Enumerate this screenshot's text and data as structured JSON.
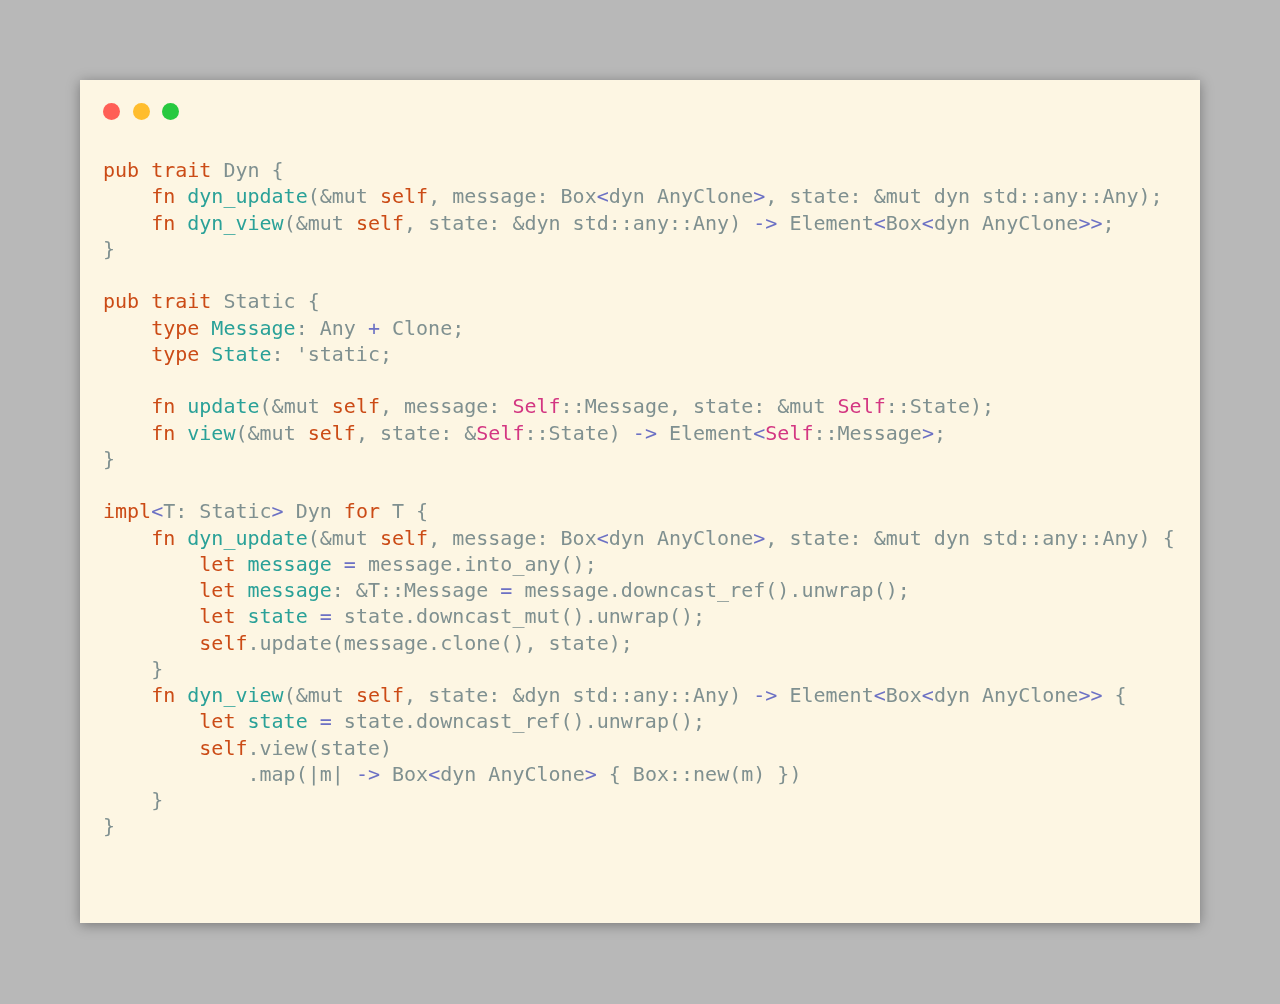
{
  "window": {
    "controls": [
      {
        "color": "#ff5f56"
      },
      {
        "color": "#ffbd2e"
      },
      {
        "color": "#27c93f"
      }
    ]
  },
  "code": {
    "blocks": [
      {
        "lines": [
          {
            "tokens": [
              {
                "text": "pub trait",
                "kind": "keyword"
              },
              {
                "text": " Dyn {",
                "kind": "plain"
              }
            ]
          },
          {
            "tokens": [
              {
                "text": "    fn",
                "kind": "keyword"
              },
              {
                "text": " dyn_update",
                "kind": "function"
              },
              {
                "text": "(&mut ",
                "kind": "plain"
              },
              {
                "text": "self",
                "kind": "keyword"
              },
              {
                "text": ", message: Box",
                "kind": "plain"
              },
              {
                "text": "<",
                "kind": "operator"
              },
              {
                "text": "dyn AnyClone",
                "kind": "plain"
              },
              {
                "text": ">",
                "kind": "operator"
              },
              {
                "text": ", state: &mut dyn std::any::Any);",
                "kind": "plain"
              }
            ]
          },
          {
            "tokens": [
              {
                "text": "    fn",
                "kind": "keyword"
              },
              {
                "text": " dyn_view",
                "kind": "function"
              },
              {
                "text": "(&mut ",
                "kind": "plain"
              },
              {
                "text": "self",
                "kind": "keyword"
              },
              {
                "text": ", state: &dyn std::any::Any) ",
                "kind": "plain"
              },
              {
                "text": "->",
                "kind": "operator"
              },
              {
                "text": " Element",
                "kind": "plain"
              },
              {
                "text": "<",
                "kind": "operator"
              },
              {
                "text": "Box",
                "kind": "plain"
              },
              {
                "text": "<",
                "kind": "operator"
              },
              {
                "text": "dyn AnyClone",
                "kind": "plain"
              },
              {
                "text": ">>",
                "kind": "operator"
              },
              {
                "text": ";",
                "kind": "plain"
              }
            ]
          },
          {
            "tokens": [
              {
                "text": "}",
                "kind": "plain"
              }
            ]
          }
        ]
      },
      {
        "lines": [
          {
            "tokens": [
              {
                "text": "pub trait",
                "kind": "keyword"
              },
              {
                "text": " Static {",
                "kind": "plain"
              }
            ]
          },
          {
            "tokens": [
              {
                "text": "    type",
                "kind": "keyword"
              },
              {
                "text": " Message",
                "kind": "function"
              },
              {
                "text": ": Any ",
                "kind": "plain"
              },
              {
                "text": "+",
                "kind": "operator"
              },
              {
                "text": " Clone;",
                "kind": "plain"
              }
            ]
          },
          {
            "tokens": [
              {
                "text": "    type",
                "kind": "keyword"
              },
              {
                "text": " State",
                "kind": "function"
              },
              {
                "text": ": 'static;",
                "kind": "plain"
              }
            ]
          }
        ]
      },
      {
        "lines": [
          {
            "tokens": [
              {
                "text": "    fn",
                "kind": "keyword"
              },
              {
                "text": " update",
                "kind": "function"
              },
              {
                "text": "(&mut ",
                "kind": "plain"
              },
              {
                "text": "self",
                "kind": "keyword"
              },
              {
                "text": ", message: ",
                "kind": "plain"
              },
              {
                "text": "Self",
                "kind": "self_type"
              },
              {
                "text": "::Message, state: &mut ",
                "kind": "plain"
              },
              {
                "text": "Self",
                "kind": "self_type"
              },
              {
                "text": "::State);",
                "kind": "plain"
              }
            ]
          },
          {
            "tokens": [
              {
                "text": "    fn",
                "kind": "keyword"
              },
              {
                "text": " view",
                "kind": "function"
              },
              {
                "text": "(&mut ",
                "kind": "plain"
              },
              {
                "text": "self",
                "kind": "keyword"
              },
              {
                "text": ", state: &",
                "kind": "plain"
              },
              {
                "text": "Self",
                "kind": "self_type"
              },
              {
                "text": "::State) ",
                "kind": "plain"
              },
              {
                "text": "->",
                "kind": "operator"
              },
              {
                "text": " Element",
                "kind": "plain"
              },
              {
                "text": "<",
                "kind": "operator"
              },
              {
                "text": "Self",
                "kind": "self_type"
              },
              {
                "text": "::Message",
                "kind": "plain"
              },
              {
                "text": ">",
                "kind": "operator"
              },
              {
                "text": ";",
                "kind": "plain"
              }
            ]
          },
          {
            "tokens": [
              {
                "text": "}",
                "kind": "plain"
              }
            ]
          }
        ]
      },
      {
        "lines": [
          {
            "tokens": [
              {
                "text": "impl",
                "kind": "keyword"
              },
              {
                "text": "<",
                "kind": "operator"
              },
              {
                "text": "T: Static",
                "kind": "plain"
              },
              {
                "text": ">",
                "kind": "operator"
              },
              {
                "text": " Dyn ",
                "kind": "plain"
              },
              {
                "text": "for",
                "kind": "keyword"
              },
              {
                "text": " T {",
                "kind": "plain"
              }
            ]
          },
          {
            "tokens": [
              {
                "text": "    fn",
                "kind": "keyword"
              },
              {
                "text": " dyn_update",
                "kind": "function"
              },
              {
                "text": "(&mut ",
                "kind": "plain"
              },
              {
                "text": "self",
                "kind": "keyword"
              },
              {
                "text": ", message: Box",
                "kind": "plain"
              },
              {
                "text": "<",
                "kind": "operator"
              },
              {
                "text": "dyn AnyClone",
                "kind": "plain"
              },
              {
                "text": ">",
                "kind": "operator"
              },
              {
                "text": ", state: &mut dyn std::any::Any) {",
                "kind": "plain"
              }
            ]
          },
          {
            "tokens": [
              {
                "text": "        let",
                "kind": "keyword"
              },
              {
                "text": " message",
                "kind": "function"
              },
              {
                "text": " =",
                "kind": "operator"
              },
              {
                "text": " message.into_any();",
                "kind": "plain"
              }
            ]
          },
          {
            "tokens": [
              {
                "text": "        let",
                "kind": "keyword"
              },
              {
                "text": " message",
                "kind": "function"
              },
              {
                "text": ": &T::Message ",
                "kind": "plain"
              },
              {
                "text": "=",
                "kind": "operator"
              },
              {
                "text": " message.downcast_ref().unwrap();",
                "kind": "plain"
              }
            ]
          },
          {
            "tokens": [
              {
                "text": "        let",
                "kind": "keyword"
              },
              {
                "text": " state",
                "kind": "function"
              },
              {
                "text": " =",
                "kind": "operator"
              },
              {
                "text": " state.downcast_mut().unwrap();",
                "kind": "plain"
              }
            ]
          },
          {
            "tokens": [
              {
                "text": "        self",
                "kind": "keyword"
              },
              {
                "text": ".update(message.clone(), state);",
                "kind": "plain"
              }
            ]
          },
          {
            "tokens": [
              {
                "text": "    }",
                "kind": "plain"
              }
            ]
          },
          {
            "tokens": [
              {
                "text": "    fn",
                "kind": "keyword"
              },
              {
                "text": " dyn_view",
                "kind": "function"
              },
              {
                "text": "(&mut ",
                "kind": "plain"
              },
              {
                "text": "self",
                "kind": "keyword"
              },
              {
                "text": ", state: &dyn std::any::Any) ",
                "kind": "plain"
              },
              {
                "text": "->",
                "kind": "operator"
              },
              {
                "text": " Element",
                "kind": "plain"
              },
              {
                "text": "<",
                "kind": "operator"
              },
              {
                "text": "Box",
                "kind": "plain"
              },
              {
                "text": "<",
                "kind": "operator"
              },
              {
                "text": "dyn AnyClone",
                "kind": "plain"
              },
              {
                "text": ">>",
                "kind": "operator"
              },
              {
                "text": " {",
                "kind": "plain"
              }
            ]
          },
          {
            "tokens": [
              {
                "text": "        let",
                "kind": "keyword"
              },
              {
                "text": " state",
                "kind": "function"
              },
              {
                "text": " =",
                "kind": "operator"
              },
              {
                "text": " state.downcast_ref().unwrap();",
                "kind": "plain"
              }
            ]
          },
          {
            "tokens": [
              {
                "text": "        self",
                "kind": "keyword"
              },
              {
                "text": ".view(state)",
                "kind": "plain"
              }
            ]
          },
          {
            "tokens": [
              {
                "text": "            .map(|m| ",
                "kind": "plain"
              },
              {
                "text": "->",
                "kind": "operator"
              },
              {
                "text": " Box",
                "kind": "plain"
              },
              {
                "text": "<",
                "kind": "operator"
              },
              {
                "text": "dyn AnyClone",
                "kind": "plain"
              },
              {
                "text": ">",
                "kind": "operator"
              },
              {
                "text": " { Box::new(m) })",
                "kind": "plain"
              }
            ]
          },
          {
            "tokens": [
              {
                "text": "    }",
                "kind": "plain"
              }
            ]
          },
          {
            "tokens": [
              {
                "text": "}",
                "kind": "plain"
              }
            ]
          }
        ]
      }
    ]
  }
}
